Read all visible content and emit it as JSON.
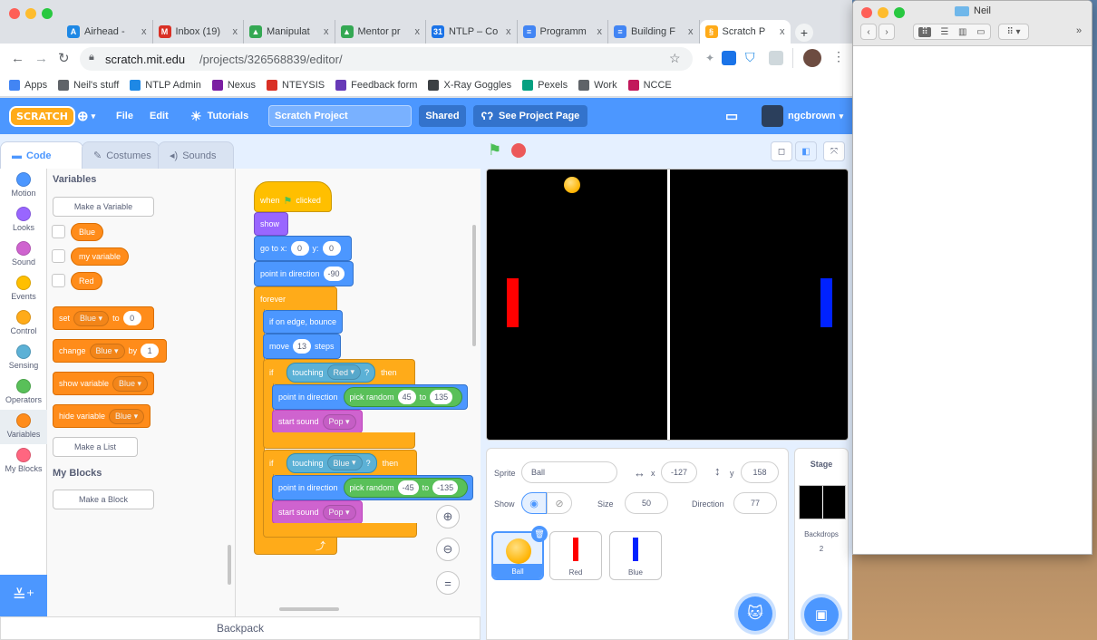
{
  "browser": {
    "tabs": [
      {
        "title": "Airhead -",
        "color": "#1e88e5",
        "glyph": "A",
        "active": false
      },
      {
        "title": "Inbox (19)",
        "color": "#d93025",
        "glyph": "M",
        "active": false
      },
      {
        "title": "Manipulat",
        "color": "#34a853",
        "glyph": "▲",
        "active": false
      },
      {
        "title": "Mentor pr",
        "color": "#34a853",
        "glyph": "▲",
        "active": false
      },
      {
        "title": "NTLP – Co",
        "color": "#1a73e8",
        "glyph": "31",
        "active": false
      },
      {
        "title": "Programm",
        "color": "#4285f4",
        "glyph": "≡",
        "active": false
      },
      {
        "title": "Building F",
        "color": "#4285f4",
        "glyph": "≡",
        "active": false
      },
      {
        "title": "Scratch P",
        "color": "#ffab19",
        "glyph": "§",
        "active": true
      }
    ],
    "new_tab": "+",
    "tab_close": "x",
    "url_host": "scratch.mit.edu",
    "url_path": "/projects/326568839/editor/",
    "bookmarks": [
      {
        "label": "Apps",
        "icon": "apps-icon",
        "color": "#4285f4"
      },
      {
        "label": "Neil's stuff",
        "icon": "folder-icon",
        "color": "#5f6368"
      },
      {
        "label": "NTLP Admin",
        "icon": "globe-icon",
        "color": "#1e88e5"
      },
      {
        "label": "Nexus",
        "icon": "diamond-icon",
        "color": "#7b1fa2"
      },
      {
        "label": "NTEYSIS",
        "icon": "bars-icon",
        "color": "#d93025"
      },
      {
        "label": "Feedback form",
        "icon": "form-icon",
        "color": "#673ab7"
      },
      {
        "label": "X-Ray Goggles",
        "icon": "goggles-icon",
        "color": "#3c4043"
      },
      {
        "label": "Pexels",
        "icon": "pexels-icon",
        "color": "#05a081"
      },
      {
        "label": "Work",
        "icon": "folder-icon",
        "color": "#5f6368"
      },
      {
        "label": "NCCE",
        "icon": "check-icon",
        "color": "#c2185b"
      }
    ]
  },
  "menubar": {
    "logo": "SCRATCH",
    "file": "File",
    "edit": "Edit",
    "tutorials": "Tutorials",
    "project_title": "Scratch Project",
    "shared": "Shared",
    "see_project": "See Project Page",
    "user": "ngcbrown"
  },
  "editor_tabs": {
    "code": "Code",
    "costumes": "Costumes",
    "sounds": "Sounds"
  },
  "categories": [
    {
      "label": "Motion",
      "color": "#4c97ff"
    },
    {
      "label": "Looks",
      "color": "#9966ff"
    },
    {
      "label": "Sound",
      "color": "#cf63cf"
    },
    {
      "label": "Events",
      "color": "#ffbf00"
    },
    {
      "label": "Control",
      "color": "#ffab19"
    },
    {
      "label": "Sensing",
      "color": "#5cb1d6"
    },
    {
      "label": "Operators",
      "color": "#59c059"
    },
    {
      "label": "Variables",
      "color": "#ff8c1a"
    },
    {
      "label": "My Blocks",
      "color": "#ff6680"
    }
  ],
  "palette": {
    "variables_header": "Variables",
    "make_variable": "Make a Variable",
    "variables": [
      "Blue",
      "my variable",
      "Red"
    ],
    "set_block": {
      "verb": "set",
      "var": "Blue",
      "to": "to",
      "value": "0"
    },
    "change_block": {
      "verb": "change",
      "var": "Blue",
      "by": "by",
      "value": "1"
    },
    "show_block": {
      "verb": "show variable",
      "var": "Blue"
    },
    "hide_block": {
      "verb": "hide variable",
      "var": "Blue"
    },
    "make_list": "Make a List",
    "myblocks_header": "My Blocks",
    "make_block": "Make a Block"
  },
  "script": {
    "when_flag": "when",
    "clicked": "clicked",
    "show": "show",
    "goto": "go to x:",
    "x": "0",
    "y_label": "y:",
    "y": "0",
    "point_dir": "point in direction",
    "dir": "-90",
    "forever": "forever",
    "edge_bounce": "if on edge, bounce",
    "move": "move",
    "steps_val": "13",
    "steps": "steps",
    "if": "if",
    "then": "then",
    "touching": "touching",
    "red": "Red",
    "blue": "Blue",
    "qmark": "?",
    "pick_random": "pick random",
    "to": "to",
    "rand1_from": "45",
    "rand1_to": "135",
    "rand2_from": "-45",
    "rand2_to": "-135",
    "start_sound": "start sound",
    "pop": "Pop"
  },
  "backpack": "Backpack",
  "sprite_info": {
    "sprite_label": "Sprite",
    "sprite_name": "Ball",
    "x_label": "x",
    "x": "-127",
    "y_label": "y",
    "y": "158",
    "show_label": "Show",
    "size_label": "Size",
    "size": "50",
    "direction_label": "Direction",
    "direction": "77"
  },
  "sprites": [
    {
      "name": "Ball",
      "selected": true
    },
    {
      "name": "Red",
      "selected": false
    },
    {
      "name": "Blue",
      "selected": false
    }
  ],
  "stage_panel": {
    "title": "Stage",
    "backdrops_label": "Backdrops",
    "backdrops_count": "2"
  },
  "finder": {
    "title": "Neil"
  },
  "colors": {
    "scratch_blue": "#4c97ff",
    "paddle_red": "#ff0000",
    "paddle_blue": "#0022ff",
    "ball": "#ffb300"
  }
}
